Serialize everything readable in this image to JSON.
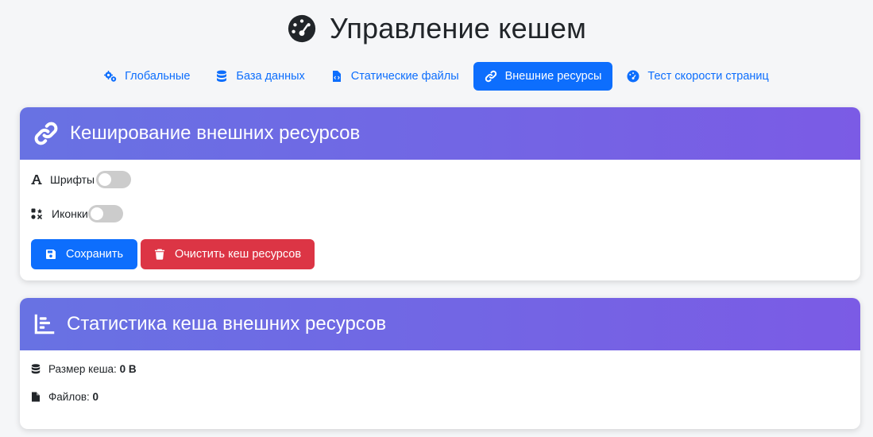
{
  "page": {
    "title": "Управление кешем",
    "title_icon": "gauge-icon"
  },
  "tabs": [
    {
      "label": "Глобальные",
      "icon": "gears-icon",
      "active": false
    },
    {
      "label": "База данных",
      "icon": "database-icon",
      "active": false
    },
    {
      "label": "Статические файлы",
      "icon": "file-code-icon",
      "active": false
    },
    {
      "label": "Внешние ресурсы",
      "icon": "link-icon",
      "active": true
    },
    {
      "label": "Тест скорости страниц",
      "icon": "gauge-icon",
      "active": false
    }
  ],
  "resources_card": {
    "title": "Кеширование внешних ресурсов",
    "icon": "link-icon",
    "toggles": [
      {
        "label": "Шрифты",
        "icon": "font-icon",
        "checked": false
      },
      {
        "label": "Иконки",
        "icon": "icons-icon",
        "checked": false
      }
    ],
    "save_label": "Сохранить",
    "clear_label": "Очистить кеш ресурсов"
  },
  "stats_card": {
    "title": "Статистика кеша внешних ресурсов",
    "icon": "chart-simple-icon",
    "size_label": "Размер кеша:",
    "size_value": "0 B",
    "files_label": "Файлов:",
    "files_value": "0"
  },
  "colors": {
    "primary": "#0d6efd",
    "danger": "#dc3545",
    "header_gradient_start": "#6872e3",
    "header_gradient_end": "#7b5be5"
  }
}
